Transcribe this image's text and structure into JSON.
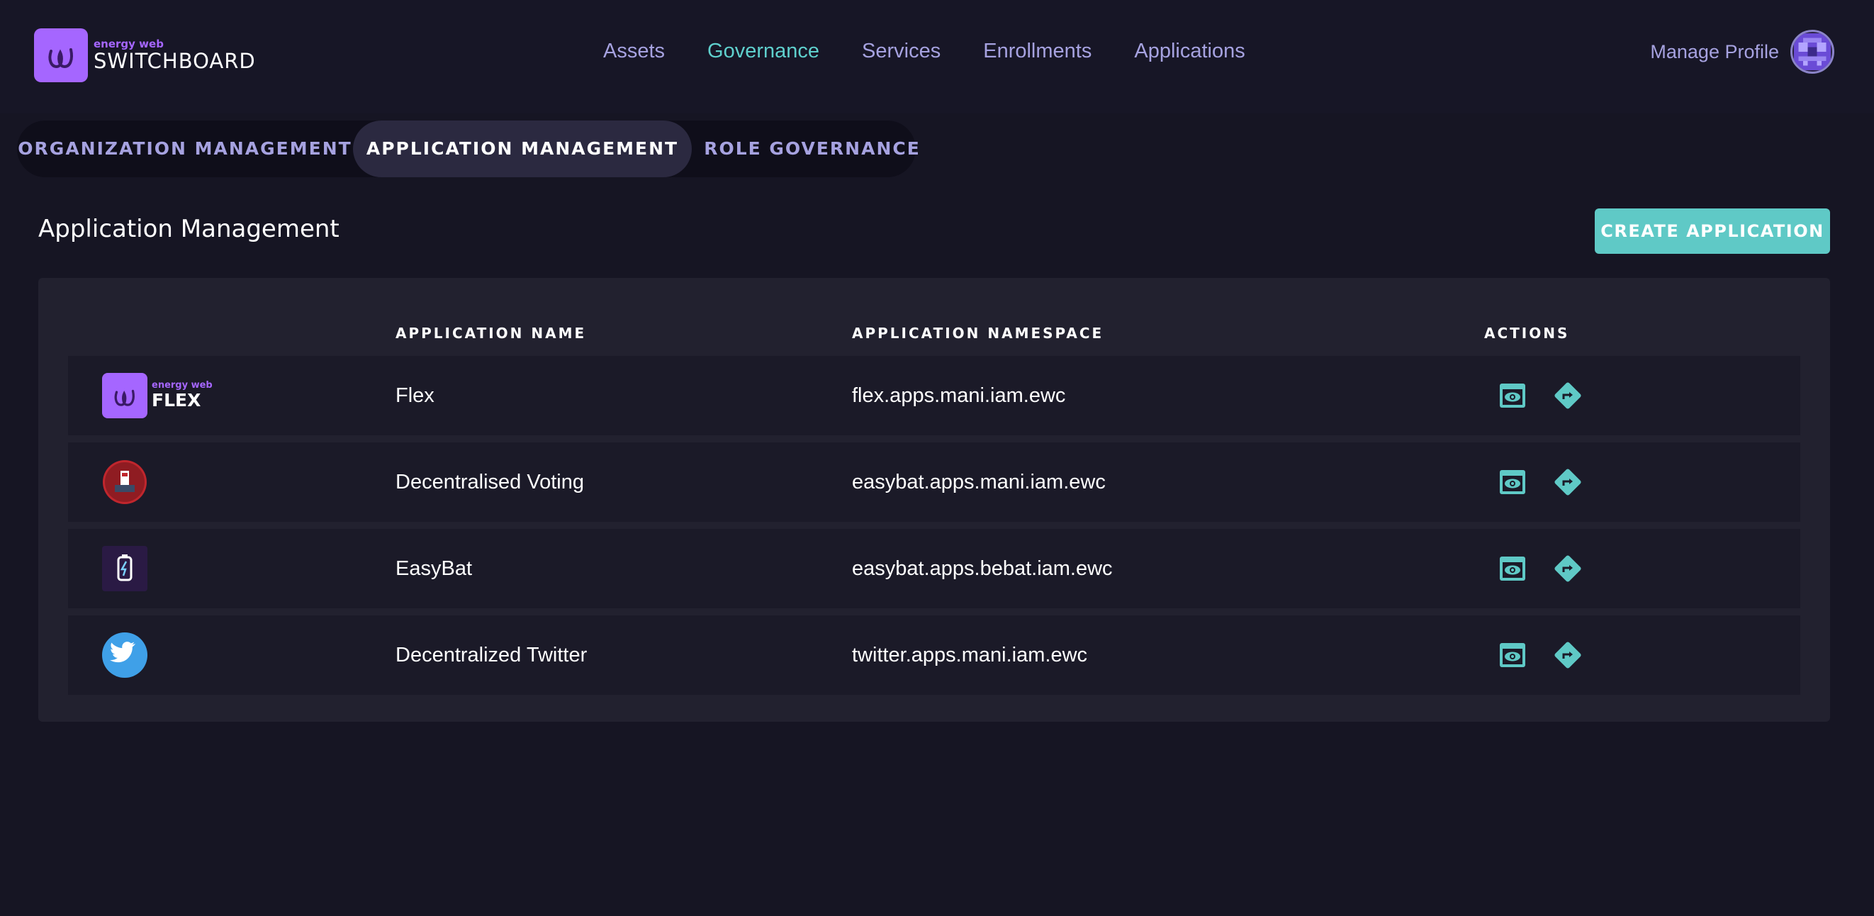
{
  "brand": {
    "small": "energy web",
    "big": "SWITCHBOARD"
  },
  "nav": [
    {
      "label": "Assets",
      "active": false
    },
    {
      "label": "Governance",
      "active": true
    },
    {
      "label": "Services",
      "active": false
    },
    {
      "label": "Enrollments",
      "active": false
    },
    {
      "label": "Applications",
      "active": false
    }
  ],
  "profile": {
    "label": "Manage Profile",
    "avatar_icon": "pixel-avatar-icon"
  },
  "tabs": [
    {
      "label": "ORGANIZATION MANAGEMENT",
      "active": false
    },
    {
      "label": "APPLICATION MANAGEMENT",
      "active": true
    },
    {
      "label": "ROLE GOVERNANCE",
      "active": false
    }
  ],
  "section": {
    "title": "Application Management",
    "create_label": "CREATE APPLICATION"
  },
  "table": {
    "headers": {
      "name": "APPLICATION NAME",
      "namespace": "APPLICATION NAMESPACE",
      "actions": "ACTIONS"
    },
    "rows": [
      {
        "logo": "energy-web-flex-logo",
        "logo_small": "energy web",
        "logo_big": "FLEX",
        "name": "Flex",
        "namespace": "flex.apps.mani.iam.ewc"
      },
      {
        "logo": "voting-logo",
        "name": "Decentralised Voting",
        "namespace": "easybat.apps.mani.iam.ewc"
      },
      {
        "logo": "easybat-logo",
        "name": "EasyBat",
        "namespace": "easybat.apps.bebat.iam.ewc"
      },
      {
        "logo": "twitter-logo",
        "name": "Decentralized Twitter",
        "namespace": "twitter.apps.mani.iam.ewc"
      }
    ],
    "action_icons": [
      "view-icon",
      "transfer-icon"
    ]
  },
  "colors": {
    "background": "#161523",
    "accent": "#5fc9c6",
    "nav_text": "#a6a2e0",
    "brand": "#a566ff"
  }
}
